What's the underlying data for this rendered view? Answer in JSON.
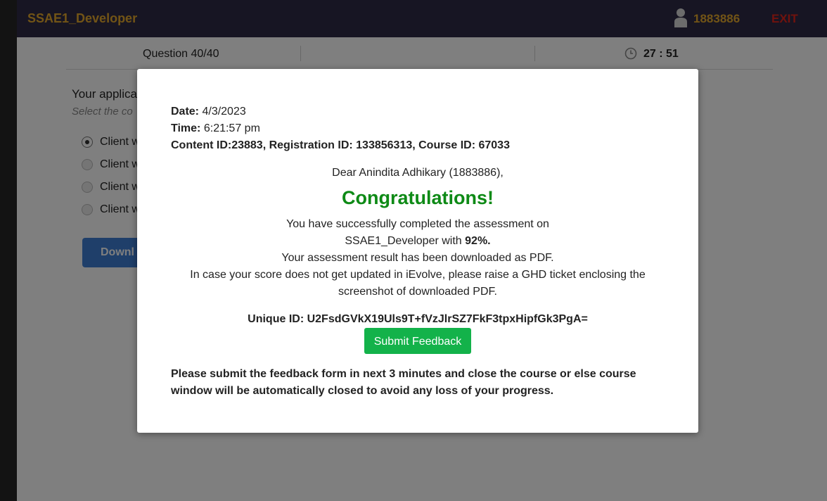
{
  "header": {
    "app_title": "SSAE1_Developer",
    "user_id": "1883886",
    "exit_label": "EXIT",
    "user_icon": "user-icon"
  },
  "question_bar": {
    "question_prefix": "Question",
    "question_number": "40/40",
    "timer": "27 : 51",
    "clock_icon": "clock-icon"
  },
  "question": {
    "text": "Your applica",
    "hint": "Select the co",
    "options": [
      {
        "label": "Client w",
        "selected": true
      },
      {
        "label": "Client w",
        "selected": false
      },
      {
        "label": "Client w",
        "selected": false
      },
      {
        "label": "Client w",
        "selected": false
      }
    ],
    "download_label": "Downl"
  },
  "modal": {
    "date_label": "Date:",
    "date_value": "4/3/2023",
    "time_label": "Time:",
    "time_value": "6:21:57 pm",
    "ids_line": "Content ID:23883, Registration ID: 133856313, Course ID: 67033",
    "greeting": "Dear Anindita Adhikary (1883886),",
    "congrats": "Congratulations!",
    "line1": "You have successfully completed the assessment on",
    "line2_course": "SSAE1_Developer",
    "line2_with": "with",
    "line2_score": "92%.",
    "line3": "Your assessment result has been downloaded as PDF.",
    "line4": "In case your score does not get updated in iEvolve, please raise a GHD ticket enclosing the",
    "line5": "screenshot of downloaded PDF.",
    "unique_id": "Unique ID: U2FsdGVkX19Uls9T+fVzJlrSZ7FkF3tpxHipfGk3PgA=",
    "submit_feedback_label": "Submit Feedback",
    "footer": "Please submit the feedback form in next 3 minutes and close the course or else course window will be automatically closed to avoid any loss of your progress."
  },
  "colors": {
    "header_bg": "#2e2a47",
    "brand_text": "#e5a92c",
    "exit": "#e0241b",
    "congrats_green": "#0e8a16",
    "submit_green": "#13b24a",
    "download_blue": "#3f7fd4"
  }
}
